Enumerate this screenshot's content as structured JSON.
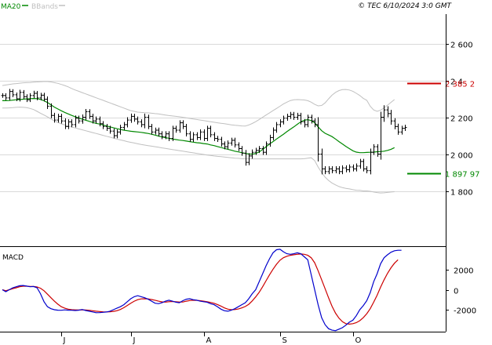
{
  "header": {
    "legend_ma": "MA20",
    "legend_bb": "BBands",
    "copyright": "© TEC 6/10/2024 3:0 GMT"
  },
  "macd_panel": {
    "title": "MACD"
  },
  "colors": {
    "price_bar": "#000000",
    "ma": "#008800",
    "bbands": "#c0c0c0",
    "macd_line": "#0000cc",
    "signal_line": "#cc0000",
    "resistance": "#cc0000",
    "support": "#008800",
    "grid": "#d9d9d9"
  },
  "chart_data": [
    {
      "type": "ohlc",
      "panel": "price",
      "ylim": [
        1500,
        2760
      ],
      "y_ticks": [
        1800,
        2000,
        2200,
        2400,
        2600
      ],
      "y_tick_labels": [
        "1 800",
        "2 000",
        "2 200",
        "2 4",
        "2 600"
      ],
      "x_tick_labels": [
        "J",
        "J",
        "A",
        "S",
        "O"
      ],
      "series": [
        {
          "name": "Price",
          "close": [
            2318,
            2305,
            2340,
            2322,
            2300,
            2335,
            2312,
            2295,
            2318,
            2330,
            2305,
            2320,
            2298,
            2260,
            2210,
            2185,
            2205,
            2180,
            2150,
            2175,
            2160,
            2195,
            2180,
            2200,
            2230,
            2205,
            2180,
            2190,
            2165,
            2150,
            2140,
            2125,
            2100,
            2120,
            2145,
            2160,
            2185,
            2205,
            2190,
            2175,
            2160,
            2200,
            2150,
            2120,
            2130,
            2110,
            2095,
            2110,
            2085,
            2140,
            2130,
            2170,
            2150,
            2110,
            2080,
            2105,
            2090,
            2120,
            2085,
            2140,
            2105,
            2085,
            2080,
            2055,
            2040,
            2060,
            2075,
            2050,
            2030,
            2005,
            1955,
            1990,
            2010,
            2020,
            2030,
            2010,
            2055,
            2090,
            2130,
            2160,
            2175,
            2195,
            2205,
            2215,
            2200,
            2210,
            2175,
            2160,
            2200,
            2180,
            2160,
            2000,
            1920,
            1905,
            1920,
            1910,
            1920,
            1905,
            1925,
            1915,
            1930,
            1920,
            1935,
            1960,
            1920,
            1910,
            2010,
            2040,
            2000,
            2200,
            2240,
            2220,
            2180,
            2150,
            2120,
            2140,
            2145
          ],
          "wick": [
            25,
            25,
            28,
            25,
            25,
            28,
            25,
            25,
            25,
            28,
            25,
            25,
            25,
            30,
            30,
            28,
            28,
            28,
            28,
            28,
            28,
            30,
            28,
            30,
            30,
            28,
            28,
            28,
            28,
            28,
            28,
            28,
            28,
            28,
            28,
            28,
            30,
            30,
            28,
            28,
            28,
            40,
            28,
            28,
            28,
            28,
            28,
            28,
            28,
            28,
            28,
            28,
            28,
            28,
            28,
            28,
            28,
            28,
            28,
            28,
            28,
            28,
            28,
            28,
            28,
            28,
            28,
            28,
            28,
            28,
            35,
            30,
            30,
            28,
            28,
            28,
            28,
            30,
            30,
            28,
            28,
            28,
            28,
            28,
            28,
            28,
            28,
            30,
            28,
            28,
            28,
            80,
            60,
            28,
            28,
            28,
            28,
            28,
            28,
            28,
            28,
            28,
            28,
            28,
            28,
            28,
            40,
            28,
            28,
            60,
            50,
            40,
            40,
            30,
            30,
            28,
            28
          ]
        },
        {
          "name": "MA20",
          "values": [
            2290,
            2290,
            2291,
            2293,
            2295,
            2296,
            2298,
            2300,
            2301,
            2302,
            2301,
            2297,
            2290,
            2280,
            2268,
            2255,
            2245,
            2235,
            2226,
            2218,
            2210,
            2203,
            2196,
            2190,
            2184,
            2178,
            2172,
            2167,
            2163,
            2158,
            2153,
            2148,
            2143,
            2138,
            2134,
            2130,
            2127,
            2124,
            2122,
            2120,
            2118,
            2115,
            2112,
            2108,
            2103,
            2098,
            2093,
            2089,
            2086,
            2082,
            2079,
            2076,
            2074,
            2071,
            2068,
            2065,
            2062,
            2060,
            2057,
            2055,
            2050,
            2046,
            2041,
            2036,
            2031,
            2026,
            2021,
            2016,
            2012,
            2008,
            2004,
            2001,
            2000,
            2003,
            2012,
            2025,
            2040,
            2055,
            2068,
            2082,
            2095,
            2108,
            2122,
            2135,
            2148,
            2162,
            2175,
            2184,
            2187,
            2182,
            2170,
            2148,
            2127,
            2113,
            2104,
            2095,
            2082,
            2068,
            2055,
            2042,
            2030,
            2018,
            2011,
            2008,
            2008,
            2009,
            2010,
            2011,
            2013,
            2014,
            2016,
            2020,
            2026,
            2035
          ]
        },
        {
          "name": "BBands upper",
          "values": [
            2372,
            2375,
            2378,
            2381,
            2383,
            2385,
            2387,
            2388,
            2389,
            2391,
            2392,
            2393,
            2394,
            2394,
            2392,
            2388,
            2384,
            2378,
            2372,
            2365,
            2356,
            2348,
            2341,
            2334,
            2327,
            2320,
            2313,
            2306,
            2299,
            2292,
            2285,
            2278,
            2271,
            2264,
            2257,
            2250,
            2243,
            2236,
            2232,
            2228,
            2226,
            2225,
            2224,
            2222,
            2220,
            2218,
            2215,
            2212,
            2209,
            2207,
            2205,
            2203,
            2200,
            2197,
            2194,
            2191,
            2188,
            2185,
            2182,
            2179,
            2176,
            2173,
            2170,
            2167,
            2165,
            2162,
            2159,
            2157,
            2155,
            2153,
            2152,
            2158,
            2166,
            2176,
            2188,
            2200,
            2212,
            2224,
            2236,
            2248,
            2260,
            2272,
            2282,
            2291,
            2295,
            2296,
            2295,
            2294,
            2290,
            2282,
            2270,
            2262,
            2264,
            2278,
            2300,
            2320,
            2335,
            2345,
            2350,
            2351,
            2348,
            2341,
            2330,
            2318,
            2303,
            2292,
            2260,
            2240,
            2232,
            2238,
            2251,
            2266,
            2281,
            2296
          ]
        },
        {
          "name": "BBands lower",
          "values": [
            2250,
            2250,
            2251,
            2252,
            2254,
            2255,
            2254,
            2252,
            2248,
            2242,
            2232,
            2222,
            2212,
            2202,
            2191,
            2180,
            2172,
            2164,
            2158,
            2152,
            2147,
            2142,
            2137,
            2132,
            2127,
            2122,
            2117,
            2112,
            2107,
            2102,
            2097,
            2092,
            2087,
            2082,
            2077,
            2073,
            2068,
            2064,
            2060,
            2056,
            2052,
            2049,
            2046,
            2043,
            2040,
            2037,
            2034,
            2031,
            2028,
            2025,
            2022,
            2019,
            2016,
            2013,
            2010,
            2007,
            2004,
            2001,
            1998,
            1995,
            1993,
            1990,
            1988,
            1986,
            1984,
            1982,
            1980,
            1978,
            1977,
            1975,
            1974,
            1974,
            1974,
            1974,
            1974,
            1974,
            1974,
            1974,
            1974,
            1974,
            1974,
            1974,
            1974,
            1974,
            1974,
            1974,
            1974,
            1975,
            1978,
            1980,
            1965,
            1930,
            1900,
            1875,
            1857,
            1843,
            1833,
            1824,
            1818,
            1814,
            1811,
            1807,
            1804,
            1803,
            1800,
            1800,
            1798,
            1794,
            1791,
            1789,
            1790,
            1792,
            1794,
            1796
          ]
        }
      ],
      "annotations": [
        {
          "label": "2 385 2",
          "value": 2385.2,
          "color": "#cc0000"
        },
        {
          "label": "1 897 97",
          "value": 1897.97,
          "color": "#008800"
        }
      ]
    },
    {
      "type": "line",
      "panel": "macd",
      "ylim": [
        -4200,
        4200
      ],
      "y_ticks": [
        2000,
        0,
        -2000
      ],
      "y_tick_labels": [
        "2000",
        "0",
        "-2000"
      ],
      "series": [
        {
          "name": "MACD",
          "values": [
            0,
            -200,
            0,
            200,
            300,
            400,
            420,
            360,
            300,
            320,
            200,
            -400,
            -1200,
            -1700,
            -1900,
            -2000,
            -2050,
            -2060,
            -2020,
            -2050,
            -2060,
            -2080,
            -2050,
            -1980,
            -2080,
            -2150,
            -2220,
            -2300,
            -2290,
            -2260,
            -2230,
            -2150,
            -2000,
            -1850,
            -1700,
            -1500,
            -1200,
            -900,
            -700,
            -600,
            -700,
            -800,
            -950,
            -1150,
            -1350,
            -1400,
            -1300,
            -1150,
            -1050,
            -1150,
            -1250,
            -1300,
            -1100,
            -950,
            -900,
            -1000,
            -1050,
            -1150,
            -1200,
            -1250,
            -1400,
            -1500,
            -1700,
            -1950,
            -2100,
            -2150,
            -2050,
            -1900,
            -1700,
            -1500,
            -1300,
            -900,
            -400,
            0,
            800,
            1600,
            2400,
            3100,
            3700,
            4000,
            4050,
            3800,
            3600,
            3550,
            3600,
            3700,
            3600,
            3300,
            3000,
            1500,
            0,
            -1500,
            -2800,
            -3500,
            -3900,
            -4050,
            -4100,
            -3950,
            -3800,
            -3550,
            -3250,
            -3050,
            -2600,
            -2000,
            -1600,
            -1100,
            -300,
            800,
            1600,
            2600,
            3200,
            3500,
            3750,
            3900,
            3950,
            3950
          ]
        },
        {
          "name": "Signal",
          "values": [
            0,
            -100,
            0,
            100,
            200,
            300,
            350,
            350,
            330,
            320,
            280,
            150,
            -100,
            -450,
            -800,
            -1150,
            -1450,
            -1700,
            -1850,
            -1950,
            -2000,
            -2020,
            -2030,
            -2020,
            -2030,
            -2060,
            -2100,
            -2150,
            -2180,
            -2210,
            -2220,
            -2210,
            -2170,
            -2100,
            -1980,
            -1800,
            -1580,
            -1350,
            -1150,
            -1000,
            -920,
            -900,
            -920,
            -980,
            -1050,
            -1150,
            -1220,
            -1240,
            -1200,
            -1180,
            -1200,
            -1230,
            -1230,
            -1150,
            -1080,
            -1050,
            -1060,
            -1100,
            -1150,
            -1200,
            -1270,
            -1360,
            -1480,
            -1640,
            -1820,
            -1950,
            -2000,
            -1990,
            -1930,
            -1820,
            -1680,
            -1460,
            -1120,
            -720,
            -260,
            300,
            900,
            1500,
            2050,
            2550,
            2950,
            3200,
            3350,
            3450,
            3500,
            3550,
            3580,
            3550,
            3450,
            3200,
            2700,
            1900,
            1000,
            100,
            -800,
            -1650,
            -2350,
            -2850,
            -3200,
            -3400,
            -3450,
            -3400,
            -3300,
            -3100,
            -2800,
            -2400,
            -1900,
            -1250,
            -550,
            250,
            1000,
            1650,
            2200,
            2650,
            3000
          ]
        }
      ]
    }
  ]
}
